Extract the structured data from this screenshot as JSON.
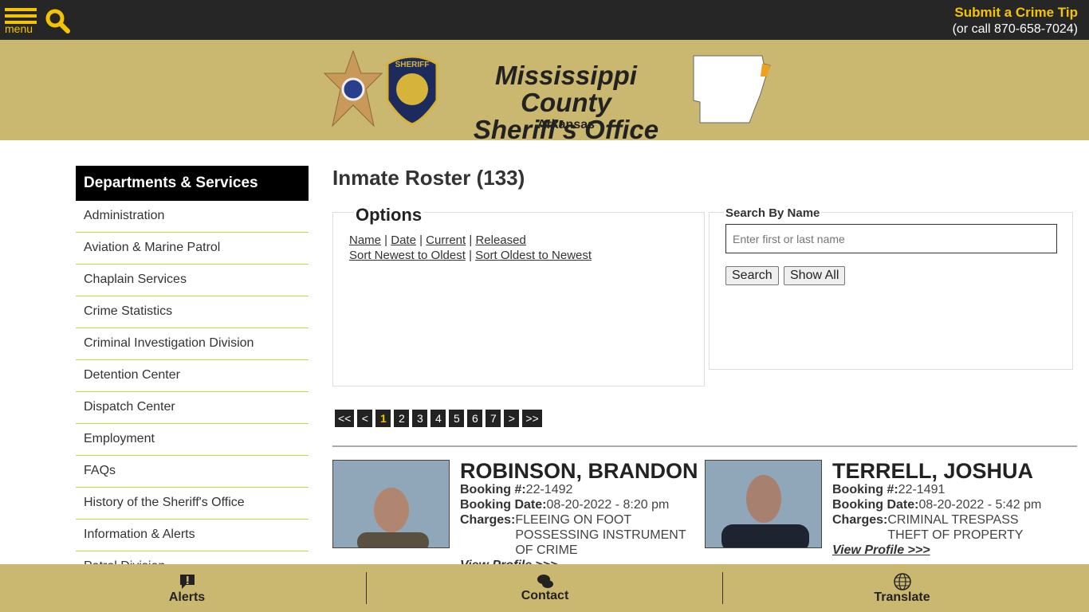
{
  "topbar": {
    "menu_label": "menu",
    "tip_title": "Submit a Crime Tip",
    "tip_phone": "(or call 870-658-7024)"
  },
  "banner": {
    "title_line1": "Mississippi County",
    "title_line2": "Sheriff's Office",
    "subtitle": "Arkansas",
    "badge_text": "SHERIFF"
  },
  "sidebar": {
    "heading": "Departments & Services",
    "items": [
      "Administration",
      "Aviation & Marine Patrol",
      "Chaplain Services",
      "Crime Statistics",
      "Criminal Investigation Division",
      "Detention Center",
      "Dispatch Center",
      "Employment",
      "FAQs",
      "History of the Sheriff's Office",
      "Information & Alerts",
      "Patrol Division"
    ]
  },
  "main": {
    "title": "Inmate Roster (133)",
    "options": {
      "title": "Options",
      "sort_by": [
        "Name",
        "Date",
        "Current",
        "Released"
      ],
      "order": [
        "Sort Newest to Oldest",
        "Sort Oldest to Newest"
      ]
    },
    "search": {
      "title": "Search By Name",
      "placeholder": "Enter first or last name",
      "search_label": "Search",
      "show_all_label": "Show All"
    },
    "pagination": [
      "<<",
      "<",
      "1",
      "2",
      "3",
      "4",
      "5",
      "6",
      "7",
      ">",
      ">>"
    ],
    "current_page": "1",
    "inmates": [
      {
        "name": "ROBINSON, BRANDON",
        "booking_label": "Booking #:",
        "booking": "22-1492",
        "date_label": "Booking Date:",
        "date": "08-20-2022 - 8:20 pm",
        "charges_label": "Charges:",
        "charges": [
          "FLEEING ON FOOT",
          "POSSESSING INSTRUMENT OF CRIME"
        ],
        "view": "View Profile >>>"
      },
      {
        "name": "TERRELL, JOSHUA",
        "booking_label": "Booking #:",
        "booking": "22-1491",
        "date_label": "Booking Date:",
        "date": "08-20-2022 - 5:42 pm",
        "charges_label": "Charges:",
        "charges": [
          "CRIMINAL TRESPASS",
          "THEFT OF PROPERTY"
        ],
        "view": "View Profile >>>"
      }
    ]
  },
  "footer": {
    "alerts": "Alerts",
    "contact": "Contact",
    "translate": "Translate"
  },
  "colors": {
    "topbar": "#262626",
    "accent": "#f5c400",
    "banner": "#cbb870"
  }
}
